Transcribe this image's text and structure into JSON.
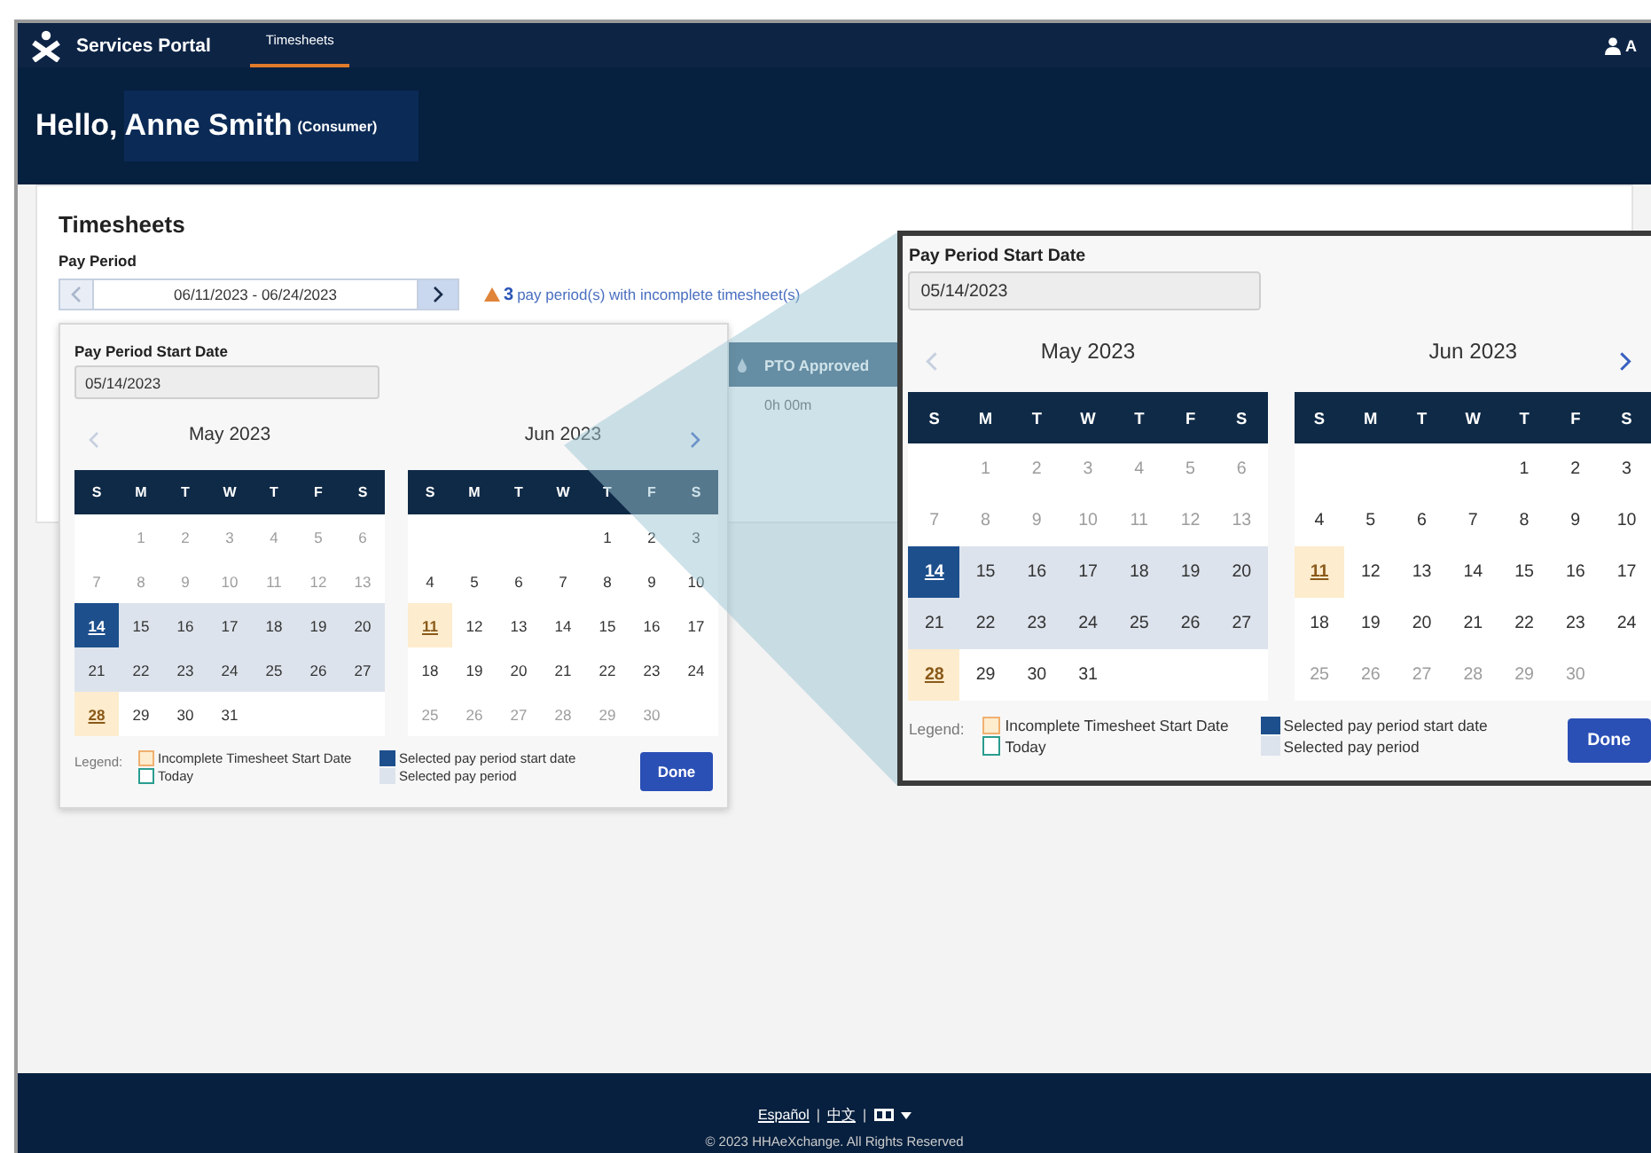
{
  "header": {
    "app_name": "Services Portal",
    "tabs": [
      {
        "label": "Timesheets",
        "selected": true
      }
    ],
    "user_initial": "A"
  },
  "greeting": {
    "hello": "Hello,",
    "name": "Anne Smith",
    "role": "(Consumer)"
  },
  "page": {
    "title": "Timesheets",
    "pay_period_label": "Pay Period",
    "pay_period_value": "06/11/2023 - 06/24/2023",
    "prev_disabled": true,
    "warning_count": "3",
    "warning_text": "pay period(s) with incomplete timesheet(s)"
  },
  "table": {
    "columns": [
      {
        "label": "PTO Approved"
      }
    ],
    "rows": [
      [
        "0h 00m"
      ]
    ]
  },
  "date_popup": {
    "label": "Pay Period Start Date",
    "value": "05/14/2023",
    "prev_disabled": true,
    "months": [
      {
        "title": "May 2023",
        "weekdays": [
          "S",
          "M",
          "T",
          "W",
          "T",
          "F",
          "S"
        ],
        "weeks": [
          [
            {
              "kind": "blank"
            },
            {
              "day": "1",
              "kind": "disabled"
            },
            {
              "day": "2",
              "kind": "disabled"
            },
            {
              "day": "3",
              "kind": "disabled"
            },
            {
              "day": "4",
              "kind": "disabled"
            },
            {
              "day": "5",
              "kind": "disabled"
            },
            {
              "day": "6",
              "kind": "disabled"
            }
          ],
          [
            {
              "day": "7",
              "kind": "disabled"
            },
            {
              "day": "8",
              "kind": "disabled"
            },
            {
              "day": "9",
              "kind": "disabled"
            },
            {
              "day": "10",
              "kind": "disabled"
            },
            {
              "day": "11",
              "kind": "disabled"
            },
            {
              "day": "12",
              "kind": "disabled"
            },
            {
              "day": "13",
              "kind": "disabled"
            }
          ],
          [
            {
              "day": "14",
              "kind": "start"
            },
            {
              "day": "15",
              "kind": "period"
            },
            {
              "day": "16",
              "kind": "period"
            },
            {
              "day": "17",
              "kind": "period"
            },
            {
              "day": "18",
              "kind": "period"
            },
            {
              "day": "19",
              "kind": "period"
            },
            {
              "day": "20",
              "kind": "period"
            }
          ],
          [
            {
              "day": "21",
              "kind": "period"
            },
            {
              "day": "22",
              "kind": "period"
            },
            {
              "day": "23",
              "kind": "period"
            },
            {
              "day": "24",
              "kind": "period"
            },
            {
              "day": "25",
              "kind": "period"
            },
            {
              "day": "26",
              "kind": "period"
            },
            {
              "day": "27",
              "kind": "period"
            }
          ],
          [
            {
              "day": "28",
              "kind": "incomplete"
            },
            {
              "day": "29",
              "kind": "normal"
            },
            {
              "day": "30",
              "kind": "normal"
            },
            {
              "day": "31",
              "kind": "normal"
            },
            {
              "kind": "blank"
            },
            {
              "kind": "blank"
            },
            {
              "kind": "blank"
            }
          ]
        ]
      },
      {
        "title": "Jun 2023",
        "weekdays": [
          "S",
          "M",
          "T",
          "W",
          "T",
          "F",
          "S"
        ],
        "weeks": [
          [
            {
              "kind": "blank"
            },
            {
              "kind": "blank"
            },
            {
              "kind": "blank"
            },
            {
              "kind": "blank"
            },
            {
              "day": "1",
              "kind": "normal"
            },
            {
              "day": "2",
              "kind": "normal"
            },
            {
              "day": "3",
              "kind": "normal"
            }
          ],
          [
            {
              "day": "4",
              "kind": "normal"
            },
            {
              "day": "5",
              "kind": "normal"
            },
            {
              "day": "6",
              "kind": "normal"
            },
            {
              "day": "7",
              "kind": "normal"
            },
            {
              "day": "8",
              "kind": "normal"
            },
            {
              "day": "9",
              "kind": "normal"
            },
            {
              "day": "10",
              "kind": "normal"
            }
          ],
          [
            {
              "day": "11",
              "kind": "incomplete"
            },
            {
              "day": "12",
              "kind": "normal"
            },
            {
              "day": "13",
              "kind": "normal"
            },
            {
              "day": "14",
              "kind": "normal"
            },
            {
              "day": "15",
              "kind": "normal"
            },
            {
              "day": "16",
              "kind": "normal"
            },
            {
              "day": "17",
              "kind": "normal"
            }
          ],
          [
            {
              "day": "18",
              "kind": "normal"
            },
            {
              "day": "19",
              "kind": "normal"
            },
            {
              "day": "20",
              "kind": "normal"
            },
            {
              "day": "21",
              "kind": "normal"
            },
            {
              "day": "22",
              "kind": "normal"
            },
            {
              "day": "23",
              "kind": "normal"
            },
            {
              "day": "24",
              "kind": "normal"
            }
          ],
          [
            {
              "day": "25",
              "kind": "disabled"
            },
            {
              "day": "26",
              "kind": "disabled"
            },
            {
              "day": "27",
              "kind": "disabled"
            },
            {
              "day": "28",
              "kind": "disabled"
            },
            {
              "day": "29",
              "kind": "disabled"
            },
            {
              "day": "30",
              "kind": "disabled"
            },
            {
              "kind": "blank"
            }
          ]
        ]
      }
    ],
    "legend_label": "Legend:",
    "legend": [
      {
        "kind": "incomplete",
        "label": "Incomplete Timesheet Start Date"
      },
      {
        "kind": "today",
        "label": "Today"
      },
      {
        "kind": "start",
        "label": "Selected pay period start date"
      },
      {
        "kind": "period",
        "label": "Selected pay period"
      }
    ],
    "done": "Done"
  },
  "magnified_popup": {
    "label": "Pay Period Start Date",
    "value": "05/14/2023",
    "prev_disabled": true,
    "months": [
      {
        "title": "May 2023",
        "weekdays": [
          "S",
          "M",
          "T",
          "W",
          "T",
          "F",
          "S"
        ],
        "weeks": [
          [
            {
              "kind": "blank"
            },
            {
              "day": "1",
              "kind": "disabled"
            },
            {
              "day": "2",
              "kind": "disabled"
            },
            {
              "day": "3",
              "kind": "disabled"
            },
            {
              "day": "4",
              "kind": "disabled"
            },
            {
              "day": "5",
              "kind": "disabled"
            },
            {
              "day": "6",
              "kind": "disabled"
            }
          ],
          [
            {
              "day": "7",
              "kind": "disabled"
            },
            {
              "day": "8",
              "kind": "disabled"
            },
            {
              "day": "9",
              "kind": "disabled"
            },
            {
              "day": "10",
              "kind": "disabled"
            },
            {
              "day": "11",
              "kind": "disabled"
            },
            {
              "day": "12",
              "kind": "disabled"
            },
            {
              "day": "13",
              "kind": "disabled"
            }
          ],
          [
            {
              "day": "14",
              "kind": "start"
            },
            {
              "day": "15",
              "kind": "period"
            },
            {
              "day": "16",
              "kind": "period"
            },
            {
              "day": "17",
              "kind": "period"
            },
            {
              "day": "18",
              "kind": "period"
            },
            {
              "day": "19",
              "kind": "period"
            },
            {
              "day": "20",
              "kind": "period"
            }
          ],
          [
            {
              "day": "21",
              "kind": "period"
            },
            {
              "day": "22",
              "kind": "period"
            },
            {
              "day": "23",
              "kind": "period"
            },
            {
              "day": "24",
              "kind": "period"
            },
            {
              "day": "25",
              "kind": "period"
            },
            {
              "day": "26",
              "kind": "period"
            },
            {
              "day": "27",
              "kind": "period"
            }
          ],
          [
            {
              "day": "28",
              "kind": "incomplete"
            },
            {
              "day": "29",
              "kind": "normal"
            },
            {
              "day": "30",
              "kind": "normal"
            },
            {
              "day": "31",
              "kind": "normal"
            },
            {
              "kind": "blank"
            },
            {
              "kind": "blank"
            },
            {
              "kind": "blank"
            }
          ]
        ]
      },
      {
        "title": "Jun 2023",
        "weekdays": [
          "S",
          "M",
          "T",
          "W",
          "T",
          "F",
          "S"
        ],
        "weeks": [
          [
            {
              "kind": "blank"
            },
            {
              "kind": "blank"
            },
            {
              "kind": "blank"
            },
            {
              "kind": "blank"
            },
            {
              "day": "1",
              "kind": "normal"
            },
            {
              "day": "2",
              "kind": "normal"
            },
            {
              "day": "3",
              "kind": "normal"
            }
          ],
          [
            {
              "day": "4",
              "kind": "normal"
            },
            {
              "day": "5",
              "kind": "normal"
            },
            {
              "day": "6",
              "kind": "normal"
            },
            {
              "day": "7",
              "kind": "normal"
            },
            {
              "day": "8",
              "kind": "normal"
            },
            {
              "day": "9",
              "kind": "normal"
            },
            {
              "day": "10",
              "kind": "normal"
            }
          ],
          [
            {
              "day": "11",
              "kind": "incomplete"
            },
            {
              "day": "12",
              "kind": "normal"
            },
            {
              "day": "13",
              "kind": "normal"
            },
            {
              "day": "14",
              "kind": "normal"
            },
            {
              "day": "15",
              "kind": "normal"
            },
            {
              "day": "16",
              "kind": "normal"
            },
            {
              "day": "17",
              "kind": "normal"
            }
          ],
          [
            {
              "day": "18",
              "kind": "normal"
            },
            {
              "day": "19",
              "kind": "normal"
            },
            {
              "day": "20",
              "kind": "normal"
            },
            {
              "day": "21",
              "kind": "normal"
            },
            {
              "day": "22",
              "kind": "normal"
            },
            {
              "day": "23",
              "kind": "normal"
            },
            {
              "day": "24",
              "kind": "normal"
            }
          ],
          [
            {
              "day": "25",
              "kind": "disabled"
            },
            {
              "day": "26",
              "kind": "disabled"
            },
            {
              "day": "27",
              "kind": "disabled"
            },
            {
              "day": "28",
              "kind": "disabled"
            },
            {
              "day": "29",
              "kind": "disabled"
            },
            {
              "day": "30",
              "kind": "disabled"
            },
            {
              "kind": "blank"
            }
          ]
        ]
      }
    ],
    "legend_label": "Legend:",
    "legend": [
      {
        "kind": "incomplete",
        "label": "Incomplete Timesheet Start Date"
      },
      {
        "kind": "today",
        "label": "Today"
      },
      {
        "kind": "start",
        "label": "Selected pay period start date"
      },
      {
        "kind": "period",
        "label": "Selected pay period"
      }
    ],
    "done": "Done"
  },
  "footer": {
    "languages": [
      "Español",
      "中文"
    ],
    "separator": "|",
    "copyright": "© 2023 HHAeXchange. All Rights Reserved"
  }
}
